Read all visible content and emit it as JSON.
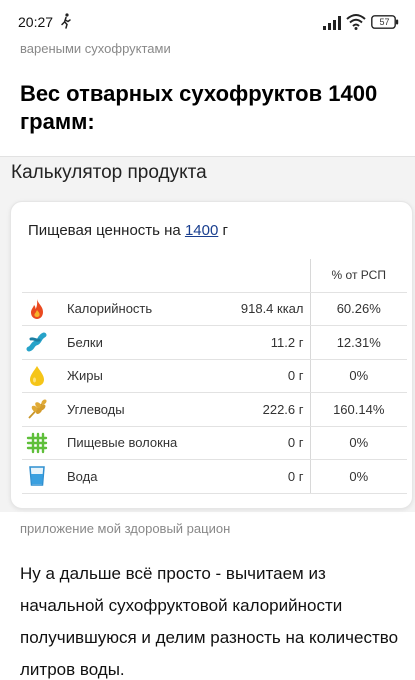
{
  "status_bar": {
    "time": "20:27",
    "battery": "57"
  },
  "article": {
    "caption_top": "вареными сухофруктами",
    "heading": "Вес отварных сухофруктов 1400 грамм:",
    "caption_mid": "приложение мой здоровый рацион",
    "body_text": "Ну а дальше всё просто - вычитаем из начальной сухофруктовой калорийности получившуюся и делим разность на количество литров воды."
  },
  "calculator": {
    "title": "Калькулятор продукта",
    "card_title_prefix": "Пищевая ценность на",
    "card_quantity": "1400",
    "card_unit": "г",
    "pct_header": "% от РСП",
    "rows": [
      {
        "icon": "fire-icon",
        "name": "Калорийность",
        "value": "918.4 ккал",
        "pct": "60.26%"
      },
      {
        "icon": "protein-icon",
        "name": "Белки",
        "value": "11.2 г",
        "pct": "12.31%"
      },
      {
        "icon": "fat-drop-icon",
        "name": "Жиры",
        "value": "0 г",
        "pct": "0%"
      },
      {
        "icon": "wheat-icon",
        "name": "Углеводы",
        "value": "222.6 г",
        "pct": "160.14%"
      },
      {
        "icon": "fiber-icon",
        "name": "Пищевые волокна",
        "value": "0 г",
        "pct": "0%"
      },
      {
        "icon": "water-glass-icon",
        "name": "Вода",
        "value": "0 г",
        "pct": "0%"
      }
    ]
  }
}
